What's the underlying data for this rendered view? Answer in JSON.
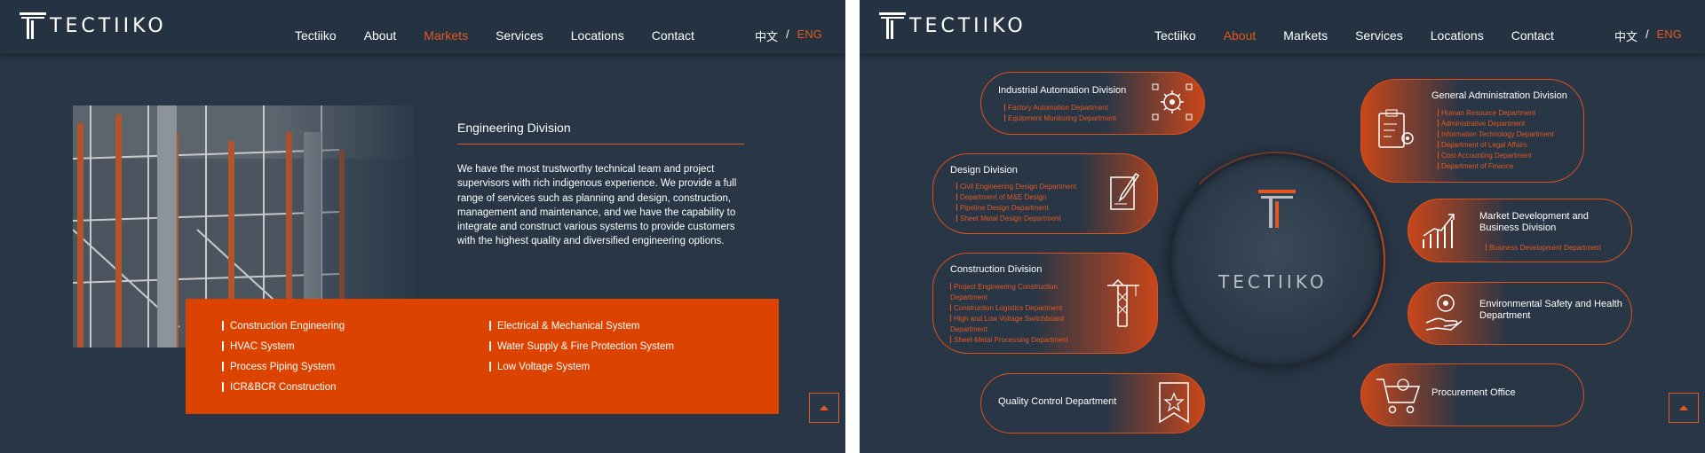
{
  "brand": {
    "name": "TECTIIKO"
  },
  "left": {
    "nav": [
      "Tectiiko",
      "About",
      "Markets",
      "Services",
      "Locations",
      "Contact"
    ],
    "active_nav": "Markets",
    "lang_cn": "中文",
    "lang_sep": "/",
    "lang_en": "ENG",
    "division_title": "Engineering Division",
    "division_text": "We have the most trustworthy technical team and project supervisors with rich indigenous experience. We provide a full range of services such as planning and design, construction, management and maintenance, and we have the capability to integrate and construct various systems to provide customers with the highest quality and diversified engineering options.",
    "services_col1": [
      "Construction Engineering",
      "HVAC System",
      "Process Piping System",
      "ICR&BCR Construction"
    ],
    "services_col2": [
      "Electrical & Mechanical System",
      "Water Supply & Fire Protection System",
      "Low Voltage System"
    ]
  },
  "right": {
    "nav": [
      "Tectiiko",
      "About",
      "Markets",
      "Services",
      "Locations",
      "Contact"
    ],
    "active_nav": "About",
    "lang_cn": "中文",
    "lang_sep": "/",
    "lang_en": "ENG",
    "center_label": "TECTIIKO",
    "divisions": {
      "industrial": {
        "title": "Industrial Automation Division",
        "depts": [
          "Factory Automation Department",
          "Equipment Monitoring Department"
        ],
        "icon": "automation-gear-icon"
      },
      "design": {
        "title": "Design Division",
        "depts": [
          "Civil Engineering Design Department",
          "Department of M&E Design",
          "Pipeline Design Department",
          "Sheet Metal Design Department"
        ],
        "icon": "design-document-pen-icon"
      },
      "construction": {
        "title": "Construction Division",
        "depts": [
          "Project Engineering Construction Department",
          "Construction Logistics Department",
          "High and Low Voltage Switchboard Department",
          "Sheet-Metal Processing Department"
        ],
        "icon": "crane-icon"
      },
      "quality": {
        "title": "Quality Control Department",
        "depts": [],
        "icon": "quality-badge-icon"
      },
      "general": {
        "title": "General Administration Division",
        "depts": [
          "Human Resource Department",
          "Administrative Department",
          "Information Technology Department",
          "Department of Legal Affairs",
          "Cost Accounting Department",
          "Department of Finance"
        ],
        "icon": "clipboard-gear-icon"
      },
      "market": {
        "title": "Market Development and Business Division",
        "depts": [
          "Business Development Department"
        ],
        "icon": "growth-chart-icon"
      },
      "env": {
        "title": "Environmental Safety and Health Department",
        "depts": [],
        "icon": "hand-gear-icon"
      },
      "procurement": {
        "title": "Procurement Office",
        "depts": [],
        "icon": "shopping-cart-icon"
      }
    }
  },
  "colors": {
    "accent": "#e4581f",
    "background": "#283646",
    "orange_box": "#dd4300"
  }
}
